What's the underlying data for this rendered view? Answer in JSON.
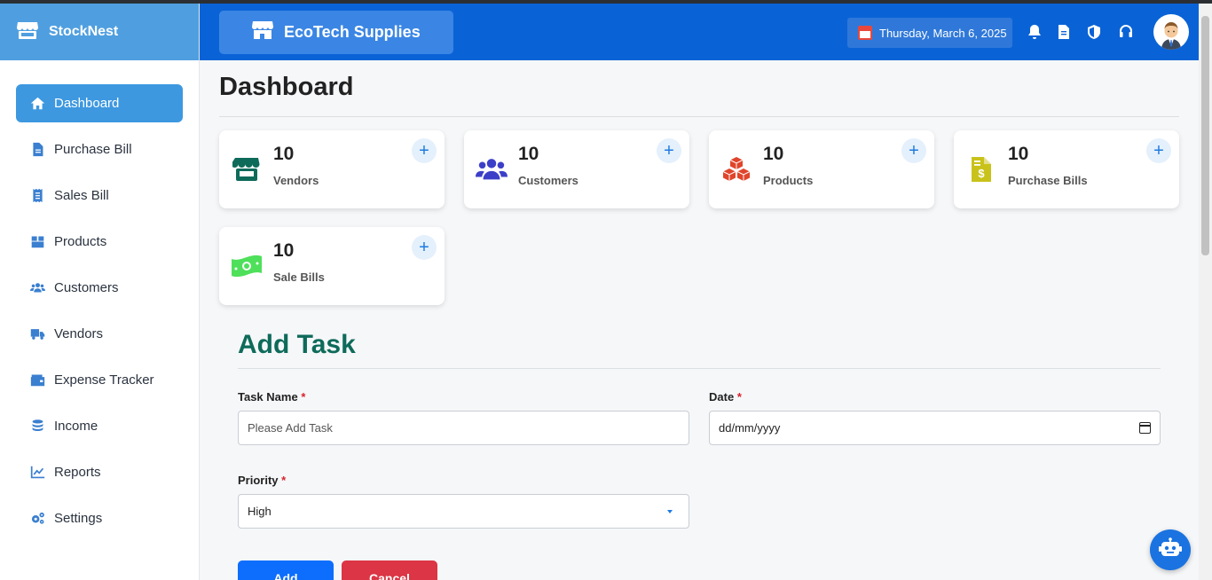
{
  "brand": {
    "name": "StockNest"
  },
  "sidebar": {
    "items": [
      {
        "label": "Dashboard",
        "icon": "home-icon"
      },
      {
        "label": "Purchase Bill",
        "icon": "file-icon"
      },
      {
        "label": "Sales Bill",
        "icon": "receipt-icon"
      },
      {
        "label": "Products",
        "icon": "box-icon"
      },
      {
        "label": "Customers",
        "icon": "users-icon"
      },
      {
        "label": "Vendors",
        "icon": "truck-icon"
      },
      {
        "label": "Expense Tracker",
        "icon": "wallet-icon"
      },
      {
        "label": "Income",
        "icon": "coins-icon"
      },
      {
        "label": "Reports",
        "icon": "chart-line-icon"
      },
      {
        "label": "Settings",
        "icon": "gears-icon"
      }
    ]
  },
  "header": {
    "store_name": "EcoTech Supplies",
    "date": "Thursday, March 6, 2025"
  },
  "main": {
    "title": "Dashboard",
    "cards": [
      {
        "count": "10",
        "label": "Vendors",
        "icon": "store-icon",
        "color": "#0e6b5a"
      },
      {
        "count": "10",
        "label": "Customers",
        "icon": "users-icon",
        "color": "#3b3fc8"
      },
      {
        "count": "10",
        "label": "Products",
        "icon": "cubes-icon",
        "color": "#e0452b"
      },
      {
        "count": "10",
        "label": "Purchase Bills",
        "icon": "invoice-dollar-icon",
        "color": "#c9c21a"
      },
      {
        "count": "10",
        "label": "Sale Bills",
        "icon": "money-bill-icon",
        "color": "#4ee05a"
      }
    ],
    "add_symbol": "+"
  },
  "form": {
    "title": "Add Task",
    "task_name_label": "Task Name",
    "task_name_placeholder": "Please Add Task",
    "date_label": "Date",
    "date_placeholder": "dd/mm/yyyy",
    "priority_label": "Priority",
    "priority_value": "High",
    "required_mark": "*",
    "add_button": "Add",
    "cancel_button": "Cancel"
  },
  "colors": {
    "brand_bar": "#4f9fe0",
    "header": "#0a63d6",
    "active_nav": "#3d98e0",
    "form_title": "#0e6b5a"
  }
}
